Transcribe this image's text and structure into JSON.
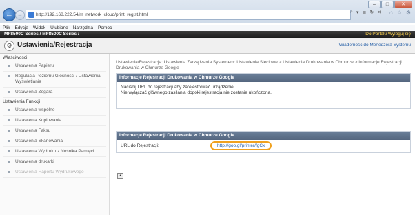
{
  "browser": {
    "url": "http://192.168.222.54/m_network_cloud/print_regist.html",
    "address_tools": [
      "⌕",
      "▾",
      "≣",
      "↻",
      "✕"
    ],
    "right_icons": [
      "⌂",
      "☆",
      "⚙"
    ],
    "menu": [
      "Plik",
      "Edycja",
      "Widok",
      "Ulubione",
      "Narzędzia",
      "Pomoc"
    ]
  },
  "header": {
    "model": "MF8500C Series / MF8500C Series /",
    "links": "Do Portalu   Wyloguj się",
    "title": "Ustawienia/Rejestracja",
    "mail_link": "Wiadomość do Menedżera Systemu"
  },
  "sidebar": {
    "groups": [
      {
        "title": "Właściwości",
        "items": [
          "Ustawienia Papieru",
          "Regulacja Poziomu Głośności / Ustawienia Wyświetlania",
          "Ustawienia Zegara"
        ]
      },
      {
        "title": "Ustawienia Funkcji",
        "items": [
          "Ustawienia wspólne",
          "Ustawienia Kopiowania",
          "Ustawienia Faksu",
          "Ustawienia Skanowania",
          "Ustawienia Wydruku z Nośnika Pamięci",
          "Ustawienia drukarki",
          "Ustawienia Raportu Wydrukowego"
        ]
      }
    ]
  },
  "main": {
    "breadcrumb": "Ustawienia/Rejestracja: Ustawienia Zarządzania Systemem: Ustawienia Sieciowe > Ustawienia Drukowania w Chmurze > Informacje Rejestracji Drukowania w Chmurze Google",
    "panel1": {
      "heading": "Informacje Rejestracji Drukowania w Chmurze Google",
      "line1": "Naciśnij URL do rejestracji aby zarejestrować urządzenie.",
      "line2": "Nie wyłączać głównego zasilania dopóki rejestracja nie zostanie ukończona."
    },
    "panel2": {
      "heading": "Informacje Rejestracji Drukowania w Chmurze Google",
      "label": "URL do Rejestracji:",
      "url": "http://goo.gl/printer/fgCx"
    }
  }
}
